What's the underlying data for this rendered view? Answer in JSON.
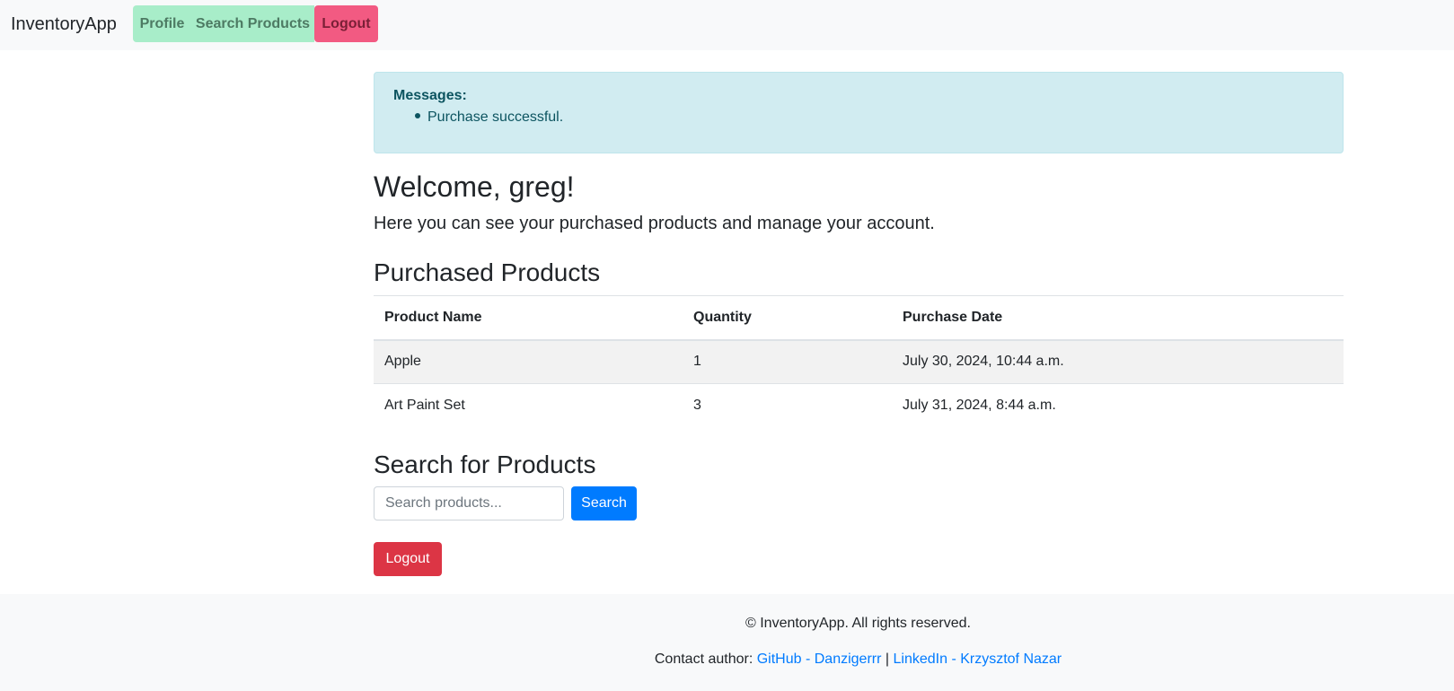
{
  "navbar": {
    "brand": "InventoryApp",
    "items": [
      {
        "label": "Profile"
      },
      {
        "label": "Search Products"
      },
      {
        "label": "Logout"
      }
    ]
  },
  "messages": {
    "title": "Messages:",
    "items": [
      "Purchase successful."
    ]
  },
  "welcome": {
    "heading": "Welcome, greg!",
    "lead": "Here you can see your purchased products and manage your account."
  },
  "purchased": {
    "heading": "Purchased Products",
    "columns": [
      "Product Name",
      "Quantity",
      "Purchase Date"
    ],
    "rows": [
      {
        "name": "Apple",
        "quantity": "1",
        "date": "July 30, 2024, 10:44 a.m."
      },
      {
        "name": "Art Paint Set",
        "quantity": "3",
        "date": "July 31, 2024, 8:44 a.m."
      }
    ]
  },
  "search": {
    "heading": "Search for Products",
    "placeholder": "Search products...",
    "button": "Search"
  },
  "logout_button": "Logout",
  "footer": {
    "copyright": "© InventoryApp. All rights reserved.",
    "contact_prefix": "Contact author:",
    "github": "GitHub - Danzigerrr",
    "separator": "|",
    "linkedin": "LinkedIn - Krzysztof Nazar"
  },
  "colors": {
    "nav_green": "#a8edc9",
    "nav_pink": "#f25a82",
    "primary": "#007bff",
    "danger": "#dc3545",
    "info_bg": "#d1ecf1"
  }
}
